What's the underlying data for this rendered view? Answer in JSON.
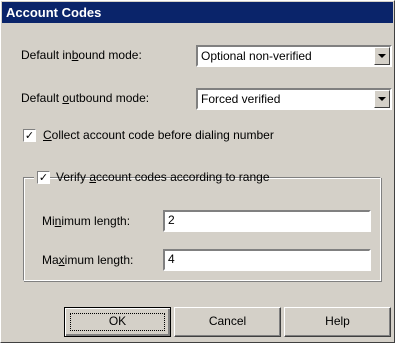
{
  "dialog": {
    "title": "Account Codes"
  },
  "inbound": {
    "label_pre": "Default in",
    "label_key": "b",
    "label_post": "ound mode:",
    "value": "Optional non-verified"
  },
  "outbound": {
    "label_pre": "Default ",
    "label_key": "o",
    "label_post": "utbound mode:",
    "value": "Forced verified"
  },
  "collect": {
    "checked": true,
    "check_glyph": "✓",
    "label_pre": "",
    "label_key": "C",
    "label_post": "ollect account code before dialing number"
  },
  "verify": {
    "checked": true,
    "check_glyph": "✓",
    "label_pre": "Verify ",
    "label_key": "a",
    "label_post": "ccount codes according to range"
  },
  "minimum": {
    "label_pre": "Mi",
    "label_key": "n",
    "label_post": "imum length:",
    "value": "2"
  },
  "maximum": {
    "label_pre": "Ma",
    "label_key": "x",
    "label_post": "imum length:",
    "value": "4"
  },
  "buttons": {
    "ok": "OK",
    "cancel": "Cancel",
    "help": "Help"
  },
  "colors": {
    "title_bar": "#0a246a",
    "face": "#d4d0c8"
  }
}
